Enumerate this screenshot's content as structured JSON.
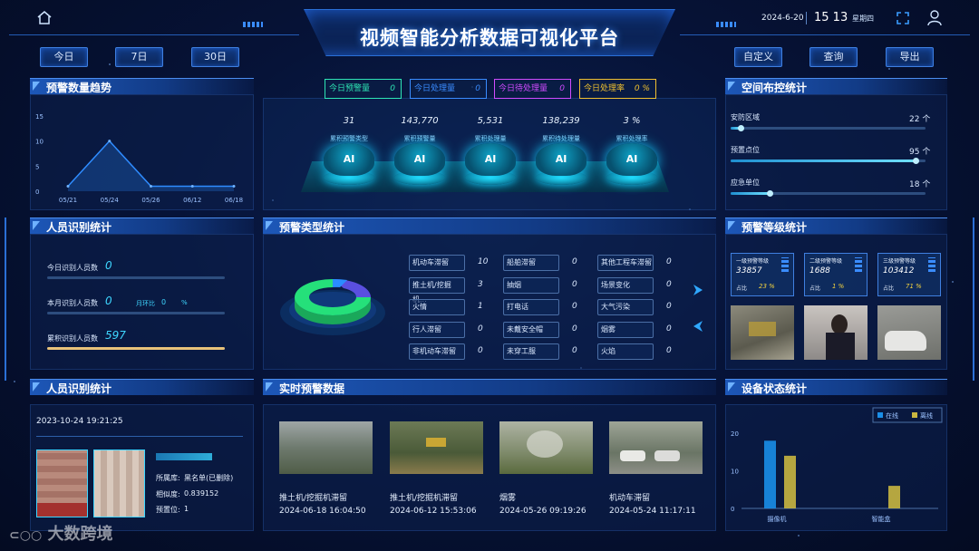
{
  "header": {
    "title": "视频智能分析数据可视化平台",
    "date": "2024-6-20",
    "time": "15 13",
    "weekday": "星期四"
  },
  "range_buttons": [
    "今日",
    "7日",
    "30日"
  ],
  "actions": [
    "自定义",
    "查询",
    "导出"
  ],
  "panels": {
    "trend": "预警数量趋势",
    "person_left": "人员识别统计",
    "type": "预警类型统计",
    "realtime": "实时预警数据",
    "space": "空间布控统计",
    "level": "预警等级统计",
    "device": "设备状态统计",
    "person_bottom": "人员识别统计"
  },
  "top_tags": [
    {
      "label": "今日预警量",
      "value": "0",
      "color": "#2ee6b5"
    },
    {
      "label": "今日处理量",
      "value": "0",
      "color": "#3a8cff"
    },
    {
      "label": "今日待处理量",
      "value": "0",
      "color": "#d04bff"
    },
    {
      "label": "今日处理率",
      "value": "0 %",
      "color": "#f0c030"
    }
  ],
  "ai_stats": [
    {
      "value": "31",
      "label": "累积预警类型"
    },
    {
      "value": "143,770",
      "label": "累积预警量"
    },
    {
      "value": "5,531",
      "label": "累积处理量"
    },
    {
      "value": "138,239",
      "label": "累积待处理量"
    },
    {
      "value": "3 %",
      "label": "累积处理率"
    }
  ],
  "space_stats": [
    {
      "label": "安防区域",
      "value": "22 个",
      "ratio": 0.05
    },
    {
      "label": "预置点位",
      "value": "95 个",
      "ratio": 0.95
    },
    {
      "label": "应急单位",
      "value": "18 个",
      "ratio": 0.2
    }
  ],
  "person_stats": {
    "today_label": "今日识别人员数",
    "today_value": "0",
    "month_label": "本月识别人员数",
    "month_value": "0",
    "mom_label": "月环比",
    "mom_value": "0",
    "mom_unit": "%",
    "total_label": "累积识别人员数",
    "total_value": "597"
  },
  "alarm_types": [
    {
      "name": "机动车滞留",
      "value": "10"
    },
    {
      "name": "船舶滞留",
      "value": "0"
    },
    {
      "name": "其他工程车滞留",
      "value": "0"
    },
    {
      "name": "推土机/挖掘机...",
      "value": "3"
    },
    {
      "name": "抽烟",
      "value": "0"
    },
    {
      "name": "场景变化",
      "value": "0"
    },
    {
      "name": "火情",
      "value": "1"
    },
    {
      "name": "打电话",
      "value": "0"
    },
    {
      "name": "大气污染",
      "value": "0"
    },
    {
      "name": "行人滞留",
      "value": "0"
    },
    {
      "name": "未戴安全帽",
      "value": "0"
    },
    {
      "name": "烟雾",
      "value": "0"
    },
    {
      "name": "非机动车滞留",
      "value": "0"
    },
    {
      "name": "未穿工服",
      "value": "0"
    },
    {
      "name": "火焰",
      "value": "0"
    }
  ],
  "levels": [
    {
      "name": "一级预警等级",
      "value": "33857",
      "ratio_label": "占比",
      "ratio": "23 %"
    },
    {
      "name": "二级预警等级",
      "value": "1688",
      "ratio_label": "占比",
      "ratio": "1 %"
    },
    {
      "name": "三级预警等级",
      "value": "103412",
      "ratio_label": "占比",
      "ratio": "71 %"
    }
  ],
  "person_record": {
    "time": "2023-10-24 19:21:25",
    "library_label": "所属库:",
    "library": "黑名单(已删除)",
    "similarity_label": "相似度:",
    "similarity": "0.839152",
    "preset_label": "预置位:",
    "preset": "1"
  },
  "realtime": [
    {
      "type": "推土机/挖掘机滞留",
      "time": "2024-06-18 16:04:50"
    },
    {
      "type": "推土机/挖掘机滞留",
      "time": "2024-06-12 15:53:06"
    },
    {
      "type": "烟雾",
      "time": "2024-05-26 09:19:26"
    },
    {
      "type": "机动车滞留",
      "time": "2024-05-24 11:17:11"
    }
  ],
  "watermark": "大数跨境",
  "chart_data": [
    {
      "type": "area",
      "title": "预警数量趋势",
      "categories": [
        "05/21",
        "05/24",
        "05/26",
        "06/12",
        "06/18"
      ],
      "values": [
        1,
        10,
        1,
        1,
        1
      ],
      "ylim": [
        0,
        15
      ],
      "yticks": [
        0,
        5,
        10,
        15
      ],
      "grid": false
    },
    {
      "type": "bar",
      "title": "设备状态统计",
      "categories": [
        "摄像机",
        "智能盒"
      ],
      "series": [
        {
          "name": "在线",
          "values": [
            18,
            0
          ]
        },
        {
          "name": "离线",
          "values": [
            14,
            6
          ]
        }
      ],
      "ylim": [
        0,
        20
      ],
      "yticks": [
        0,
        10,
        20
      ],
      "legend": "top-right",
      "colors": [
        "#1a8ee8",
        "#c9b640"
      ]
    },
    {
      "type": "pie",
      "title": "预警类型统计",
      "note": "3D donut",
      "colors": [
        "#25e07a",
        "#5a4fe0",
        "#2a8cff"
      ]
    }
  ]
}
